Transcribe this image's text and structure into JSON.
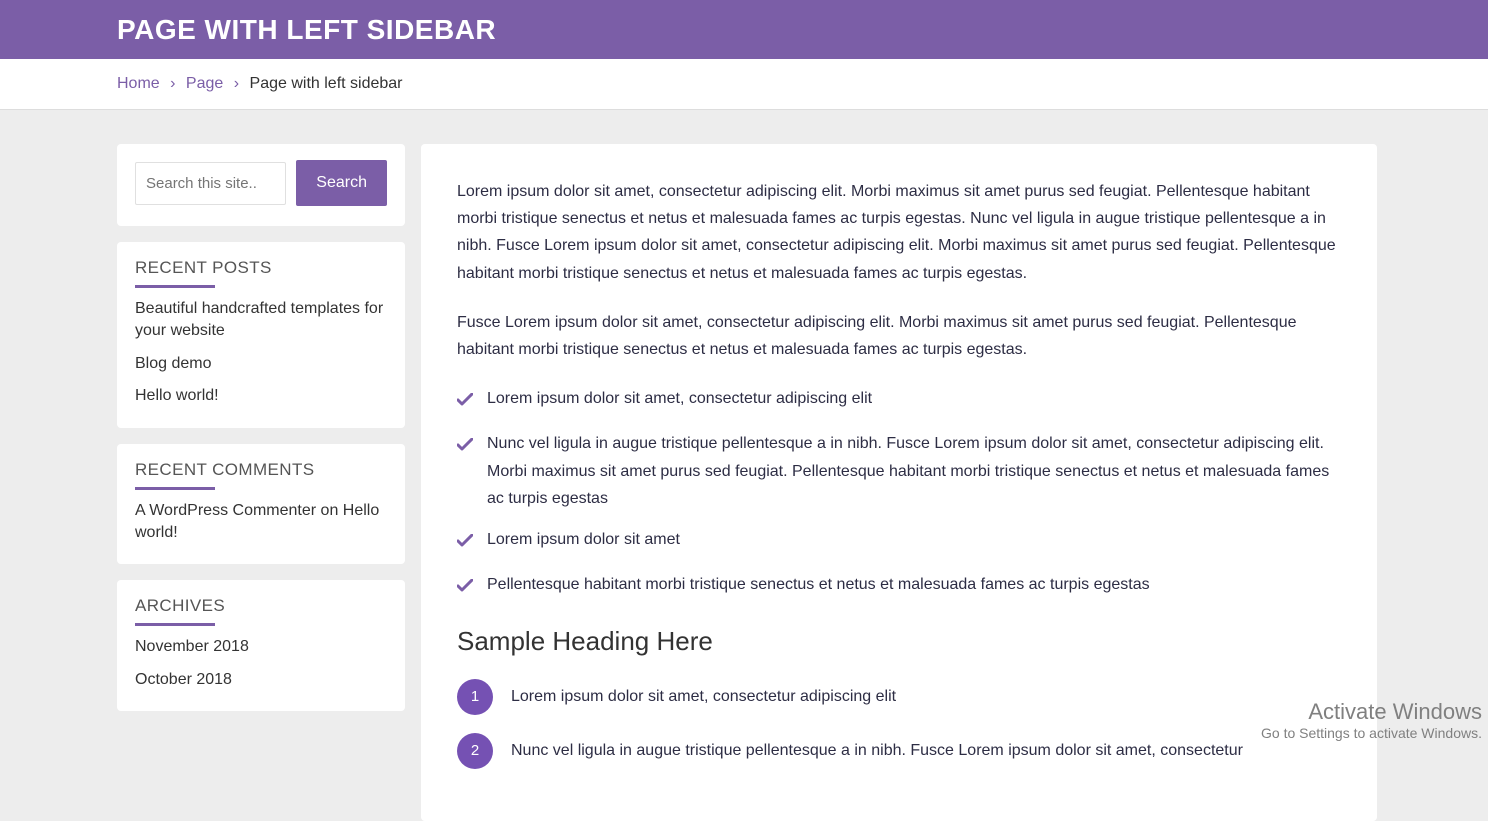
{
  "header": {
    "title": "PAGE WITH LEFT SIDEBAR"
  },
  "breadcrumb": {
    "home": "Home",
    "page": "Page",
    "current": "Page with left sidebar"
  },
  "sidebar": {
    "search": {
      "placeholder": "Search this site..",
      "button": "Search"
    },
    "recent_posts": {
      "title": "RECENT POSTS",
      "items": [
        "Beautiful handcrafted templates for your website",
        "Blog demo",
        "Hello world!"
      ]
    },
    "recent_comments": {
      "title": "RECENT COMMENTS",
      "items": [
        "A WordPress Commenter on Hello world!"
      ]
    },
    "archives": {
      "title": "ARCHIVES",
      "items": [
        "November 2018",
        "October 2018"
      ]
    }
  },
  "content": {
    "p1": "Lorem ipsum dolor sit amet, consectetur adipiscing elit. Morbi maximus sit amet purus sed feugiat. Pellentesque habitant morbi tristique senectus et netus et malesuada fames ac turpis egestas. Nunc vel ligula in augue tristique pellentesque a in nibh. Fusce Lorem ipsum dolor sit amet, consectetur adipiscing elit. Morbi maximus sit amet purus sed feugiat. Pellentesque habitant morbi tristique senectus et netus et malesuada fames ac turpis egestas.",
    "p2": "Fusce Lorem ipsum dolor sit amet, consectetur adipiscing elit. Morbi maximus sit amet purus sed feugiat. Pellentesque habitant morbi tristique senectus et netus et malesuada fames ac turpis egestas.",
    "checks": [
      "Lorem ipsum dolor sit amet, consectetur adipiscing elit",
      "Nunc vel ligula in augue tristique pellentesque a in nibh. Fusce Lorem ipsum dolor sit amet, consectetur adipiscing elit. Morbi maximus sit amet purus sed feugiat. Pellentesque habitant morbi tristique senectus et netus et malesuada fames ac turpis egestas",
      "Lorem ipsum dolor sit amet",
      "Pellentesque habitant morbi tristique senectus et netus et malesuada fames ac turpis egestas"
    ],
    "heading": "Sample Heading Here",
    "numbered": [
      "Lorem ipsum dolor sit amet, consectetur adipiscing elit",
      "Nunc vel ligula in augue tristique pellentesque a in nibh. Fusce Lorem ipsum dolor sit amet, consectetur"
    ]
  },
  "watermark": {
    "line1": "Activate Windows",
    "line2": "Go to Settings to activate Windows."
  }
}
